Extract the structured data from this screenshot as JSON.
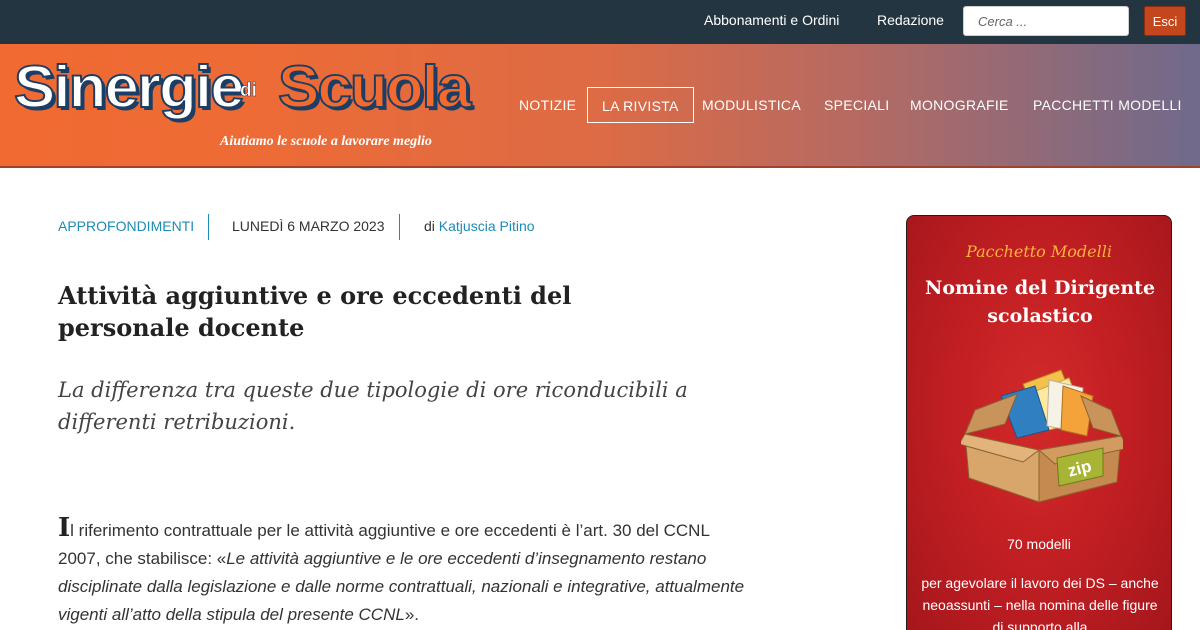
{
  "topbar": {
    "links": [
      "Abbonamenti e Ordini",
      "Redazione"
    ],
    "search_placeholder": "Cerca ...",
    "logout_label": "Esci"
  },
  "logo": {
    "word1": "Sinergie",
    "word2": "di",
    "word3": "Scuola",
    "tagline": "Aiutiamo le scuole a lavorare meglio"
  },
  "nav": {
    "items": [
      "NOTIZIE",
      "LA RIVISTA",
      "MODULISTICA",
      "SPECIALI",
      "MONOGRAFIE",
      "PACCHETTI MODELLI"
    ],
    "active": "LA RIVISTA"
  },
  "article": {
    "category": "APPROFONDIMENTI",
    "date": "LUNEDÌ 6 MARZO 2023",
    "by_prefix": "di",
    "author": "Katjuscia Pitino",
    "title": "Attività aggiuntive e ore eccedenti del personale docente",
    "subtitle": "La differenza tra queste due tipologie di ore riconducibili a differenti retribuzioni.",
    "body_dropcap": "I",
    "body_text": "l riferimento contrattuale per le attività aggiuntive e ore eccedenti è l’art. 30 del CCNL 2007, che stabilisce: «",
    "body_quote": "Le attività aggiuntive e le ore eccedenti d’insegnamento restano disciplinate dalla legislazione e dalle norme contrattuali, nazionali e integrative, attualmente vigenti all’atto della stipula del presente CCNL",
    "body_end": "»."
  },
  "sidebar_card": {
    "kicker": "Pacchetto Modelli",
    "headline": "Nomine del Dirigente scolastico",
    "box_label": "zip",
    "count": "70 modelli",
    "description": "per agevolare il lavoro dei DS – anche neoassunti – nella nomina delle figure di supporto alla"
  },
  "colors": {
    "topbar_bg": "#233541",
    "accent_blue": "#1e8bb5",
    "header_orange": "#f06a32",
    "card_red": "#c21f23",
    "card_kicker": "#f7b33c"
  }
}
